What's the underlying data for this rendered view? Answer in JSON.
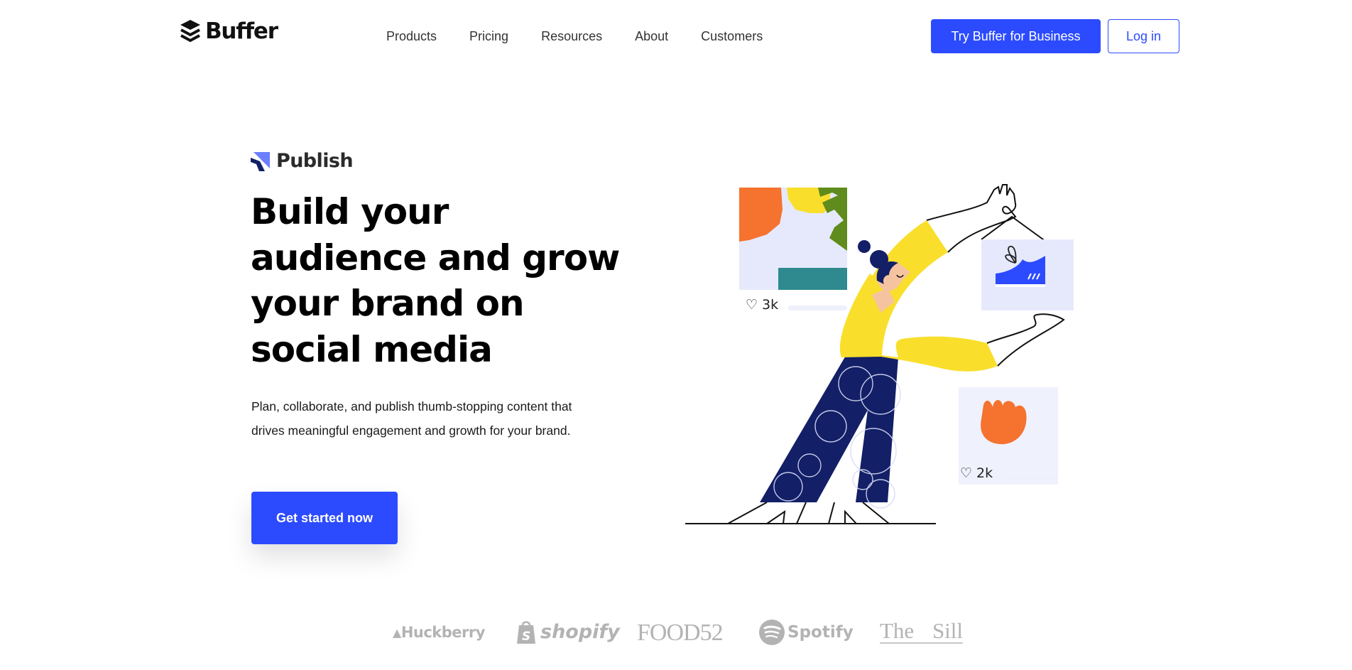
{
  "header": {
    "logo_text": "Buffer",
    "nav": [
      "Products",
      "Pricing",
      "Resources",
      "About",
      "Customers"
    ],
    "business_button": "Try Buffer for Business",
    "login_button": "Log in"
  },
  "hero": {
    "product_name": "Publish",
    "headline": "Build your audience and grow your brand on social media",
    "subtext_line1": "Plan, collaborate, and publish thumb-stopping content that",
    "subtext_line2": "drives meaningful engagement and growth for your brand.",
    "cta_label": "Get started now"
  },
  "illustration": {
    "post1_likes": "3k",
    "post2_likes": "2k"
  },
  "customer_logos": [
    "Huckberry",
    "shopify",
    "FOOD52",
    "Spotify",
    "The Sill"
  ],
  "colors": {
    "accent": "#2c4bff",
    "yellow": "#f9df2c",
    "navy": "#131f66",
    "orange": "#f5722f",
    "green": "#5f8c1c",
    "teal": "#2e8a8e",
    "card_bg": "#e6e9fc",
    "logo_gray": "#b3b3b3"
  }
}
